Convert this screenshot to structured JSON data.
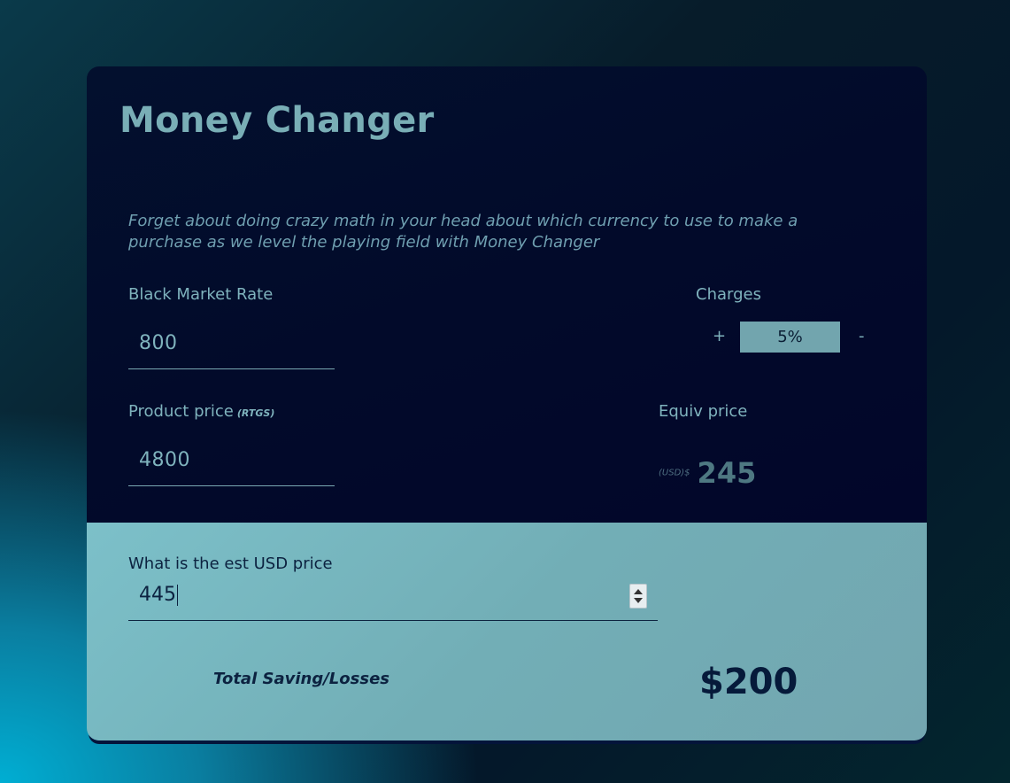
{
  "app": {
    "title": "Money Changer",
    "subtitle": "Forget about doing crazy math in your head about which currency to use to make a purchase as we level the playing field with Money Changer"
  },
  "rate": {
    "label": "Black Market Rate",
    "value": "800"
  },
  "charges": {
    "label": "Charges",
    "plus": "+",
    "minus": "-",
    "value": "5%"
  },
  "product": {
    "label": "Product price",
    "unit": "(RTGS)",
    "value": "4800"
  },
  "equiv": {
    "label": "Equiv price",
    "currency": "(USD)$",
    "value": "245"
  },
  "usd": {
    "label": "What is the est USD price",
    "value": "445"
  },
  "total": {
    "label": "Total Saving/Losses",
    "value": "$200"
  },
  "colors": {
    "accent": "#79aeb6",
    "panel_dark": "#020a2a",
    "panel_light": "#76b4bd",
    "text_dark": "#0c2240"
  }
}
